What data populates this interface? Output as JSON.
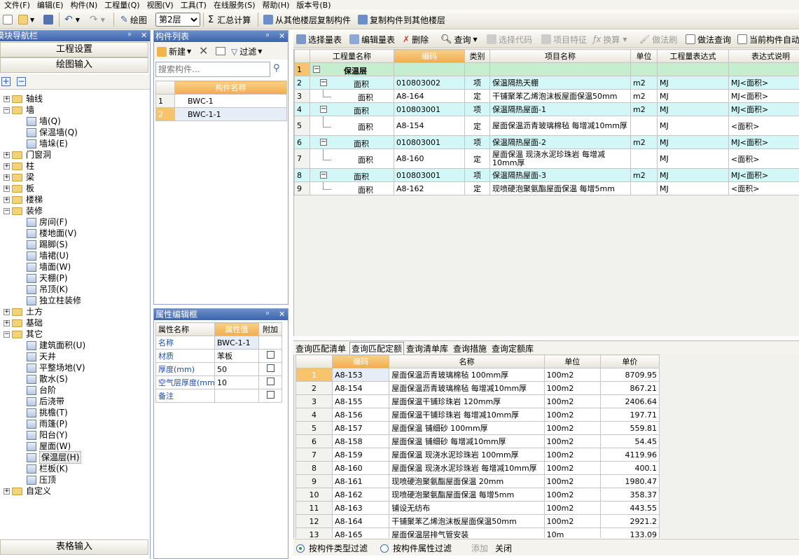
{
  "menu": [
    "文件(F)",
    "编辑(E)",
    "构件(N)",
    "工程量(Q)",
    "视图(V)",
    "工具(T)",
    "在线服务(S)",
    "帮助(H)",
    "版本号(B)"
  ],
  "toolbar": {
    "draw_label": "绘图",
    "floor_value": "第2层",
    "sum_label": "汇总计算",
    "copy_from_label": "从其他楼层复制构件",
    "copy_to_label": "复制构件到其他楼层"
  },
  "nav": {
    "title": "模块导航栏",
    "project_settings": "工程设置",
    "drawing_input": "绘图输入",
    "table_input": "表格输入",
    "tree": [
      {
        "label": "轴线",
        "level": 0,
        "type": "folder",
        "exp": "+"
      },
      {
        "label": "墙",
        "level": 0,
        "type": "folder",
        "exp": "-"
      },
      {
        "label": "墙(Q)",
        "level": 1,
        "type": "leaf"
      },
      {
        "label": "保温墙(Q)",
        "level": 1,
        "type": "leaf"
      },
      {
        "label": "墙垛(E)",
        "level": 1,
        "type": "leaf"
      },
      {
        "label": "门窗洞",
        "level": 0,
        "type": "folder",
        "exp": "+"
      },
      {
        "label": "柱",
        "level": 0,
        "type": "folder",
        "exp": "+"
      },
      {
        "label": "梁",
        "level": 0,
        "type": "folder",
        "exp": "+"
      },
      {
        "label": "板",
        "level": 0,
        "type": "folder",
        "exp": "+"
      },
      {
        "label": "楼梯",
        "level": 0,
        "type": "folder",
        "exp": "+"
      },
      {
        "label": "装修",
        "level": 0,
        "type": "folder",
        "exp": "-"
      },
      {
        "label": "房间(F)",
        "level": 1,
        "type": "leaf"
      },
      {
        "label": "楼地面(V)",
        "level": 1,
        "type": "leaf"
      },
      {
        "label": "踢脚(S)",
        "level": 1,
        "type": "leaf"
      },
      {
        "label": "墙裙(U)",
        "level": 1,
        "type": "leaf"
      },
      {
        "label": "墙面(W)",
        "level": 1,
        "type": "leaf"
      },
      {
        "label": "天棚(P)",
        "level": 1,
        "type": "leaf"
      },
      {
        "label": "吊顶(K)",
        "level": 1,
        "type": "leaf"
      },
      {
        "label": "独立柱装修",
        "level": 1,
        "type": "leaf"
      },
      {
        "label": "土方",
        "level": 0,
        "type": "folder",
        "exp": "+"
      },
      {
        "label": "基础",
        "level": 0,
        "type": "folder",
        "exp": "+"
      },
      {
        "label": "其它",
        "level": 0,
        "type": "folder",
        "exp": "-"
      },
      {
        "label": "建筑面积(U)",
        "level": 1,
        "type": "leaf"
      },
      {
        "label": "天井",
        "level": 1,
        "type": "leaf"
      },
      {
        "label": "平整场地(V)",
        "level": 1,
        "type": "leaf"
      },
      {
        "label": "散水(S)",
        "level": 1,
        "type": "leaf"
      },
      {
        "label": "台阶",
        "level": 1,
        "type": "leaf"
      },
      {
        "label": "后浇带",
        "level": 1,
        "type": "leaf"
      },
      {
        "label": "挑檐(T)",
        "level": 1,
        "type": "leaf"
      },
      {
        "label": "雨篷(P)",
        "level": 1,
        "type": "leaf"
      },
      {
        "label": "阳台(Y)",
        "level": 1,
        "type": "leaf"
      },
      {
        "label": "屋面(W)",
        "level": 1,
        "type": "leaf"
      },
      {
        "label": "保温层(H)",
        "level": 1,
        "type": "leaf",
        "selected": true
      },
      {
        "label": "栏板(K)",
        "level": 1,
        "type": "leaf"
      },
      {
        "label": "压顶",
        "level": 1,
        "type": "leaf"
      },
      {
        "label": "自定义",
        "level": 0,
        "type": "folder",
        "exp": "+"
      }
    ]
  },
  "complist": {
    "title": "构件列表",
    "new_label": "新建",
    "filter_label": "过滤",
    "search_placeholder": "搜索构件...",
    "header": "构件名称",
    "rows": [
      {
        "n": "1",
        "name": "BWC-1"
      },
      {
        "n": "2",
        "name": "BWC-1-1"
      }
    ]
  },
  "props": {
    "title": "属性编辑框",
    "headers": [
      "属性名称",
      "属性值",
      "附加"
    ],
    "rows": [
      {
        "name": "名称",
        "value": "BWC-1-1",
        "chk": false
      },
      {
        "name": "材质",
        "value": "苯板",
        "chk": true
      },
      {
        "name": "厚度(mm)",
        "value": "50",
        "chk": true
      },
      {
        "name": "空气层厚度(mm",
        "value": "10",
        "chk": true
      },
      {
        "name": "备注",
        "value": "",
        "chk": true
      }
    ]
  },
  "maintoolbar": {
    "select_qty": "选择量表",
    "edit_qty": "编辑量表",
    "delete": "删除",
    "query": "查询",
    "select_code": "选择代码",
    "item_feature": "项目特征",
    "convert": "换算",
    "method_brush": "做法刷",
    "method_query": "做法查询",
    "current_auto": "当前构件自动"
  },
  "maintable": {
    "headers": [
      "工程量名称",
      "编码",
      "类别",
      "项目名称",
      "单位",
      "工程量表达式",
      "表达式说明"
    ],
    "rows": [
      {
        "n": "1",
        "style": "green",
        "ctl": "-",
        "indent": 0,
        "qty": "保温层",
        "code": "",
        "cat": "",
        "name": "",
        "unit": "",
        "expr": "",
        "desc": "",
        "bold": true
      },
      {
        "n": "2",
        "style": "cyan",
        "ctl": "-",
        "indent": 1,
        "qty": "面积",
        "code": "010803002",
        "cat": "项",
        "name": "保温隔热天棚",
        "unit": "m2",
        "expr": "MJ",
        "desc": "MJ<面积>"
      },
      {
        "n": "3",
        "style": "",
        "ctl": "",
        "indent": 2,
        "qty": "面积",
        "code": "A8-164",
        "cat": "定",
        "name": "干铺聚苯乙烯泡沫板屋面保温50mm",
        "unit": "m2",
        "expr": "MJ",
        "desc": "MJ<面积>"
      },
      {
        "n": "4",
        "style": "cyan",
        "ctl": "-",
        "indent": 1,
        "qty": "面积",
        "code": "010803001",
        "cat": "项",
        "name": "保温隔热屋面-1",
        "unit": "m2",
        "expr": "MJ",
        "desc": "MJ<面积>"
      },
      {
        "n": "5",
        "style": "",
        "ctl": "",
        "indent": 2,
        "qty": "面积",
        "code": "A8-154",
        "cat": "定",
        "name": "屋面保温沥青玻璃棉毡 每增减10mm厚",
        "unit": "",
        "expr": "MJ",
        "desc": "<面积>",
        "tall": true
      },
      {
        "n": "6",
        "style": "cyan",
        "ctl": "-",
        "indent": 1,
        "qty": "面积",
        "code": "010803001",
        "cat": "项",
        "name": "保温隔热屋面-2",
        "unit": "m2",
        "expr": "MJ",
        "desc": "MJ<面积>"
      },
      {
        "n": "7",
        "style": "",
        "ctl": "",
        "indent": 2,
        "qty": "面积",
        "code": "A8-160",
        "cat": "定",
        "name": "屋面保温 现浇水泥珍珠岩 每增减10mm厚",
        "unit": "",
        "expr": "MJ",
        "desc": "<面积>",
        "tall": true
      },
      {
        "n": "8",
        "style": "cyan",
        "ctl": "-",
        "indent": 1,
        "qty": "面积",
        "code": "010803001",
        "cat": "项",
        "name": "保温隔热屋面-3",
        "unit": "m2",
        "expr": "MJ",
        "desc": "MJ<面积>"
      },
      {
        "n": "9",
        "style": "",
        "ctl": "",
        "indent": 2,
        "qty": "面积",
        "code": "A8-162",
        "cat": "定",
        "name": "现喷硬泡聚氨酯屋面保温 每增5mm",
        "unit": "",
        "expr": "MJ",
        "desc": "<面积>"
      }
    ]
  },
  "lowtabs": [
    "查询匹配清单",
    "查询匹配定额",
    "查询清单库",
    "查询措施",
    "查询定额库"
  ],
  "lowtable": {
    "headers": [
      "编码",
      "名称",
      "单位",
      "单价"
    ],
    "rows": [
      {
        "n": "1",
        "code": "A8-153",
        "name": "屋面保温沥青玻璃棉毡 100mm厚",
        "unit": "100m2",
        "price": "8709.95"
      },
      {
        "n": "2",
        "code": "A8-154",
        "name": "屋面保温沥青玻璃棉毡 每增减10mm厚",
        "unit": "100m2",
        "price": "867.21"
      },
      {
        "n": "3",
        "code": "A8-155",
        "name": "屋面保温干铺珍珠岩 120mm厚",
        "unit": "100m2",
        "price": "2406.64"
      },
      {
        "n": "4",
        "code": "A8-156",
        "name": "屋面保温干铺珍珠岩 每增减10mm厚",
        "unit": "100m2",
        "price": "197.71"
      },
      {
        "n": "5",
        "code": "A8-157",
        "name": "屋面保温 铺细砂 100mm厚",
        "unit": "100m2",
        "price": "559.81"
      },
      {
        "n": "6",
        "code": "A8-158",
        "name": "屋面保温 铺细砂 每增减10mm厚",
        "unit": "100m2",
        "price": "54.45"
      },
      {
        "n": "7",
        "code": "A8-159",
        "name": "屋面保温 现浇水泥珍珠岩 100mm厚",
        "unit": "100m2",
        "price": "4119.96"
      },
      {
        "n": "8",
        "code": "A8-160",
        "name": "屋面保温 现浇水泥珍珠岩 每增减10mm厚",
        "unit": "100m2",
        "price": "400.1"
      },
      {
        "n": "9",
        "code": "A8-161",
        "name": "现喷硬泡聚氨酯屋面保温 20mm",
        "unit": "100m2",
        "price": "1980.47"
      },
      {
        "n": "10",
        "code": "A8-162",
        "name": "现喷硬泡聚氨酯屋面保温 每增5mm",
        "unit": "100m2",
        "price": "358.37"
      },
      {
        "n": "11",
        "code": "A8-163",
        "name": "铺设无纺布",
        "unit": "100m2",
        "price": "443.55"
      },
      {
        "n": "12",
        "code": "A8-164",
        "name": "干铺聚苯乙烯泡沫板屋面保温50mm",
        "unit": "100m2",
        "price": "2921.2"
      },
      {
        "n": "13",
        "code": "A8-165",
        "name": "屋面保温层排气管安装",
        "unit": "10m",
        "price": "133.09"
      }
    ]
  },
  "lowbar": {
    "filter_type": "按构件类型过滤",
    "filter_attr": "按构件属性过滤",
    "add": "添加",
    "close": "关闭"
  },
  "colors": {
    "accent_orange": "#f0ad4c",
    "title_blue": "#3b64ab",
    "row_cyan": "#d3f6f6",
    "row_green": "#c5eecf"
  }
}
